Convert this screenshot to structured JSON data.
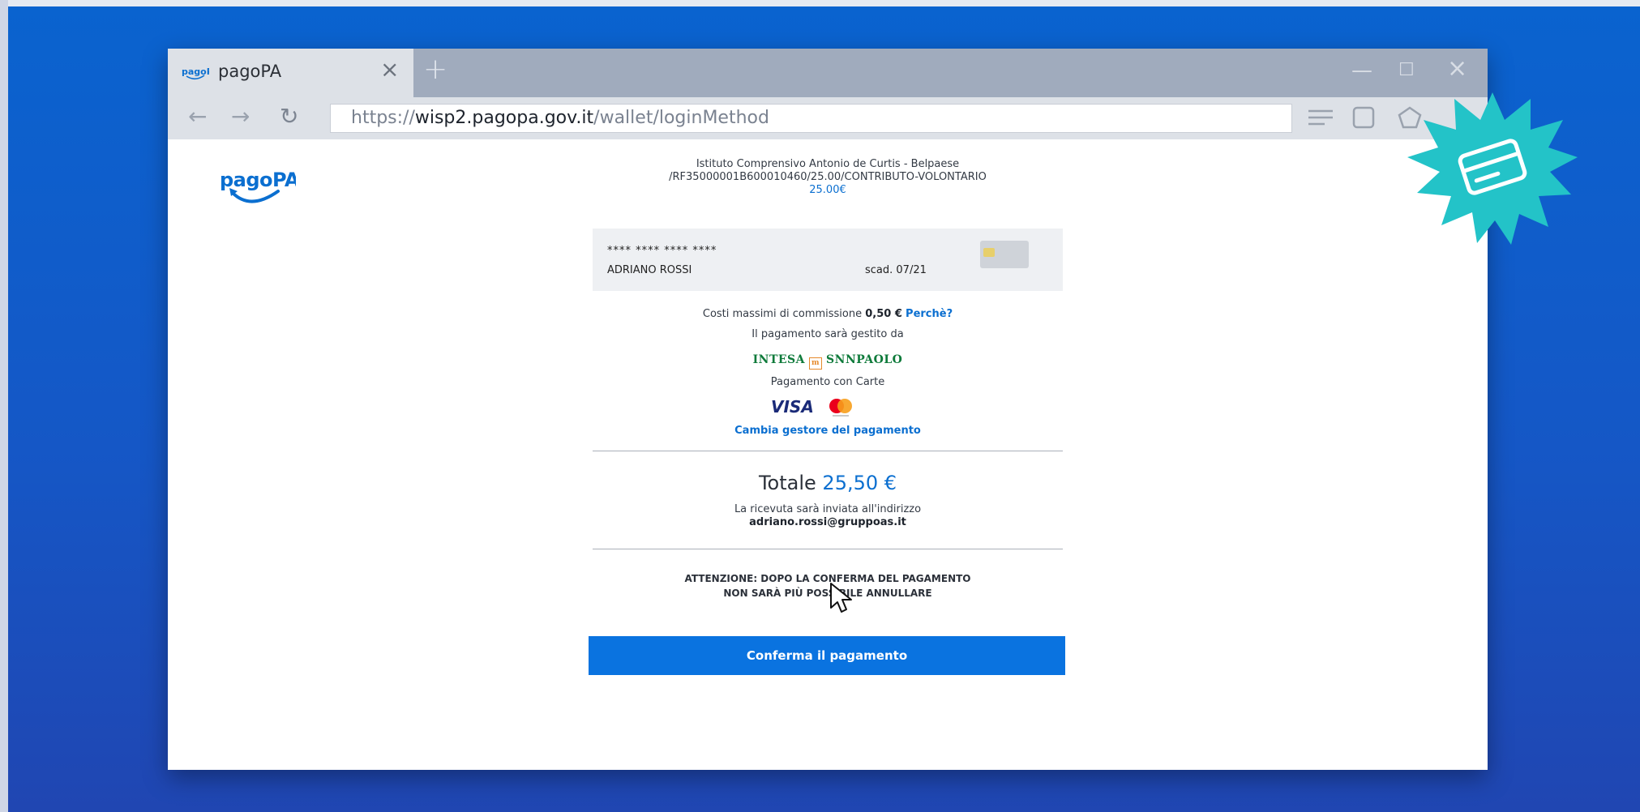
{
  "browser": {
    "tab_title": "pagoPA",
    "tab_close": "×",
    "new_tab": "+",
    "url_scheme": "https://",
    "url_host": "wisp2.pagopa.gov.it",
    "url_path": "/wallet/loginMethod",
    "nav_back": "←",
    "nav_forward": "→",
    "nav_refresh": "↻",
    "win_minimize": "—",
    "win_maximize": "☐",
    "win_close": "×"
  },
  "payment": {
    "creditor": "Istituto Comprensivo Antonio de Curtis - Belpaese",
    "reference": "/RF35000001B600010460/25.00/CONTRIBUTO-VOLONTARIO",
    "amount": "25.00€"
  },
  "card": {
    "masked_number": "**** **** **** ****",
    "holder": "ADRIANO ROSSI",
    "expiry": "scad. 07/21"
  },
  "fees": {
    "prefix": "Costi massimi di commissione",
    "amount": "0,50 €",
    "why_link": "Perchè?",
    "managed_by": "Il pagamento sarà gestito da",
    "provider_left": "INTESA",
    "provider_mark": "m",
    "provider_right": "SNNPAOLO",
    "method": "Pagamento con Carte",
    "visa": "VISA",
    "change_provider": "Cambia gestore del pagamento"
  },
  "total": {
    "label": "Totale",
    "amount": "25,50 €",
    "receipt_text": "La ricevuta sarà inviata all'indirizzo",
    "email": "adriano.rossi@gruppoas.it"
  },
  "warning": {
    "line1": "ATTENZIONE: DOPO LA CONFERMA DEL PAGAMENTO",
    "line2": "NON SARÀ PIÙ POSSIBILE ANNULLARE"
  },
  "actions": {
    "confirm_label": "Conferma il pagamento"
  },
  "colors": {
    "brand_blue": "#0a73e0",
    "badge_teal": "#23c3c8"
  }
}
